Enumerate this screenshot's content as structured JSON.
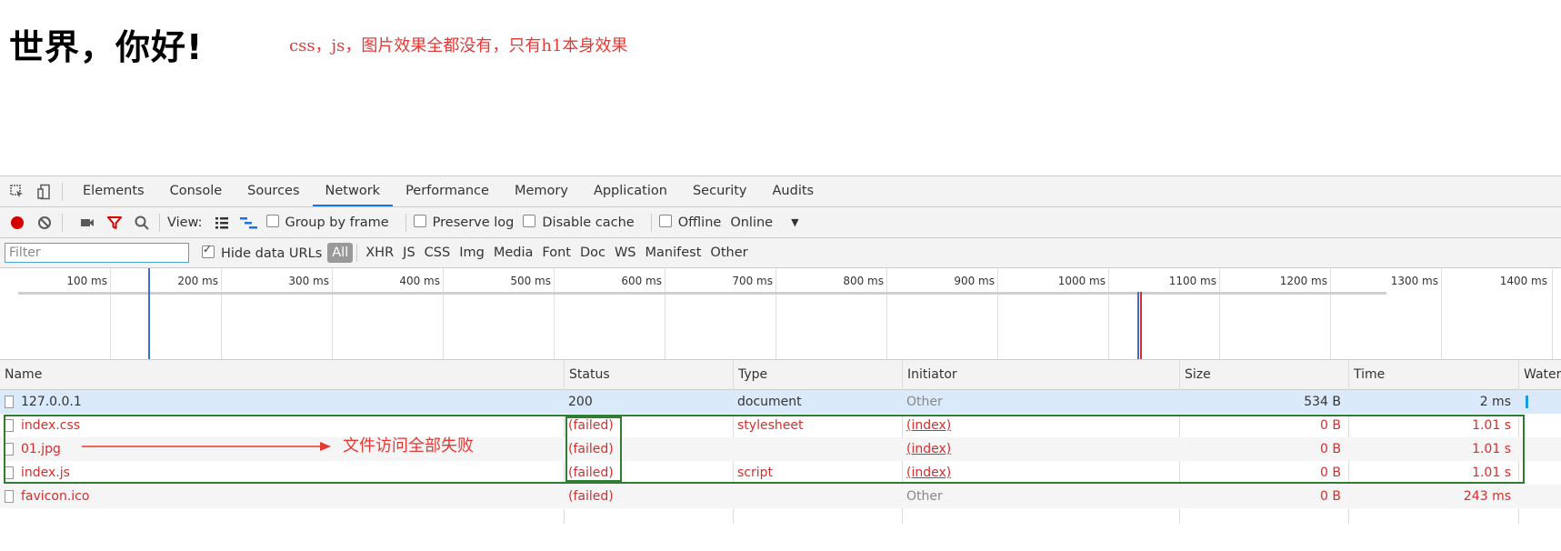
{
  "page": {
    "heading": "世界，你好!",
    "annotation": "css，js，图片效果全都没有，只有h1本身效果"
  },
  "devtools": {
    "tabs": [
      "Elements",
      "Console",
      "Sources",
      "Network",
      "Performance",
      "Memory",
      "Application",
      "Security",
      "Audits"
    ],
    "active_tab": "Network",
    "toolbar": {
      "view_label": "View:",
      "group_by_frame": "Group by frame",
      "preserve_log": "Preserve log",
      "disable_cache": "Disable cache",
      "offline": "Offline",
      "throttle": "Online"
    },
    "filter": {
      "placeholder": "Filter",
      "hide_data_urls": "Hide data URLs",
      "types": [
        "All",
        "XHR",
        "JS",
        "CSS",
        "Img",
        "Media",
        "Font",
        "Doc",
        "WS",
        "Manifest",
        "Other"
      ]
    },
    "timeline_ticks": [
      "100 ms",
      "200 ms",
      "300 ms",
      "400 ms",
      "500 ms",
      "600 ms",
      "700 ms",
      "800 ms",
      "900 ms",
      "1000 ms",
      "1100 ms",
      "1200 ms",
      "1300 ms",
      "1400 ms"
    ],
    "columns": [
      "Name",
      "Status",
      "Type",
      "Initiator",
      "Size",
      "Time",
      "Waterf"
    ],
    "requests": [
      {
        "name": "127.0.0.1",
        "status": "200",
        "type": "document",
        "initiator": "Other",
        "size": "534 B",
        "time": "2 ms"
      },
      {
        "name": "index.css",
        "status": "(failed)",
        "type": "stylesheet",
        "initiator": "(index)",
        "size": "0 B",
        "time": "1.01 s"
      },
      {
        "name": "01.jpg",
        "status": "(failed)",
        "type": "",
        "initiator": "(index)",
        "size": "0 B",
        "time": "1.01 s"
      },
      {
        "name": "index.js",
        "status": "(failed)",
        "type": "script",
        "initiator": "(index)",
        "size": "0 B",
        "time": "1.01 s"
      },
      {
        "name": "favicon.ico",
        "status": "(failed)",
        "type": "",
        "initiator": "Other",
        "size": "0 B",
        "time": "243 ms"
      }
    ],
    "failure_annotation": "文件访问全部失败"
  },
  "colors": {
    "annotation_red": "#e53935",
    "failed_red": "#d32f2f",
    "highlight_green": "#2e7d32",
    "selected_row": "#dbeafa",
    "active_tab_underline": "#1a73e8"
  }
}
